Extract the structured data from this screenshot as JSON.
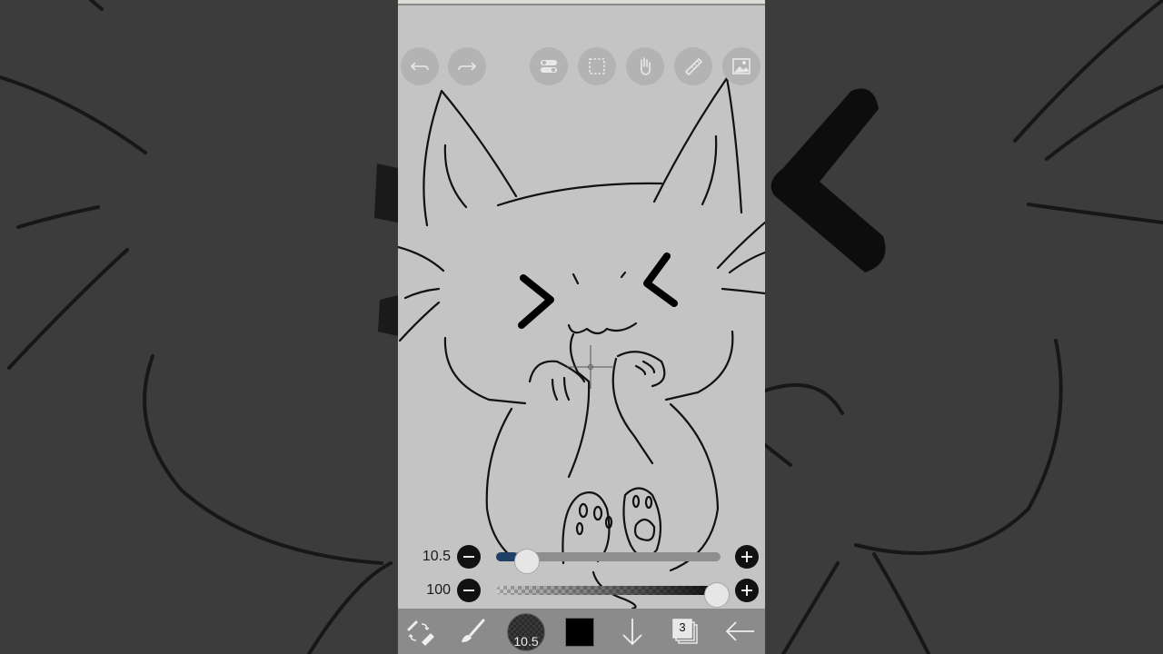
{
  "toolbar": {
    "undo_icon": "undo-icon",
    "redo_icon": "redo-icon",
    "settings_icon": "toggle-settings-icon",
    "selection_icon": "selection-icon",
    "hand_icon": "hand-icon",
    "ruler_icon": "ruler-icon",
    "image_icon": "image-icon"
  },
  "brush_size": {
    "value": "10.5",
    "fraction": 0.08
  },
  "opacity": {
    "value": "100",
    "fraction": 1.0
  },
  "bottombar": {
    "brush_size_label": "10.5",
    "color": "#000000",
    "layer_count": "3"
  },
  "colors": {
    "canvas": "#c4c4c4",
    "accent": "#1f3f66",
    "bottombar": "#8b8b8b"
  }
}
